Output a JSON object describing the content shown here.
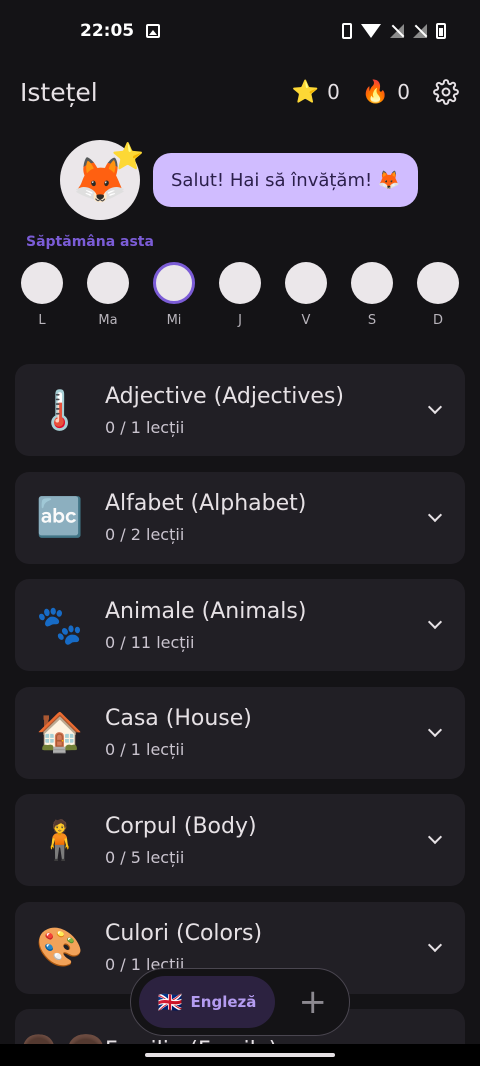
{
  "status_bar": {
    "time": "22:05"
  },
  "app_bar": {
    "title": "Istețel",
    "stars_icon": "⭐",
    "stars": "0",
    "streak_icon": "🔥",
    "streak": "0",
    "settings_icon": "gear-icon"
  },
  "mascot": {
    "avatar": "🦊",
    "badge": "⭐",
    "greeting": "Salut! Hai să învățăm! 🦊"
  },
  "week": {
    "label": "Săptămâna asta",
    "days": [
      "L",
      "Ma",
      "Mi",
      "J",
      "V",
      "S",
      "D"
    ],
    "today_index": 2
  },
  "categories": [
    {
      "icon": "🌡️",
      "title": "Adjective (Adjectives)",
      "progress": "0 / 1 lecții"
    },
    {
      "icon": "🔤",
      "title": "Alfabet (Alphabet)",
      "progress": "0 / 2 lecții"
    },
    {
      "icon": "🐾",
      "title": "Animale (Animals)",
      "progress": "0 / 11 lecții"
    },
    {
      "icon": "🏠",
      "title": "Casa (House)",
      "progress": "0 / 1 lecții"
    },
    {
      "icon": "🧍",
      "title": "Corpul (Body)",
      "progress": "0 / 5 lecții"
    },
    {
      "icon": "🎨",
      "title": "Culori (Colors)",
      "progress": "0 / 1 lecții"
    },
    {
      "icon": "👨‍👩",
      "title": "Familia (Family)",
      "progress": ""
    }
  ],
  "language": {
    "flag": "🇬🇧",
    "name": "Engleză",
    "add": "+"
  }
}
